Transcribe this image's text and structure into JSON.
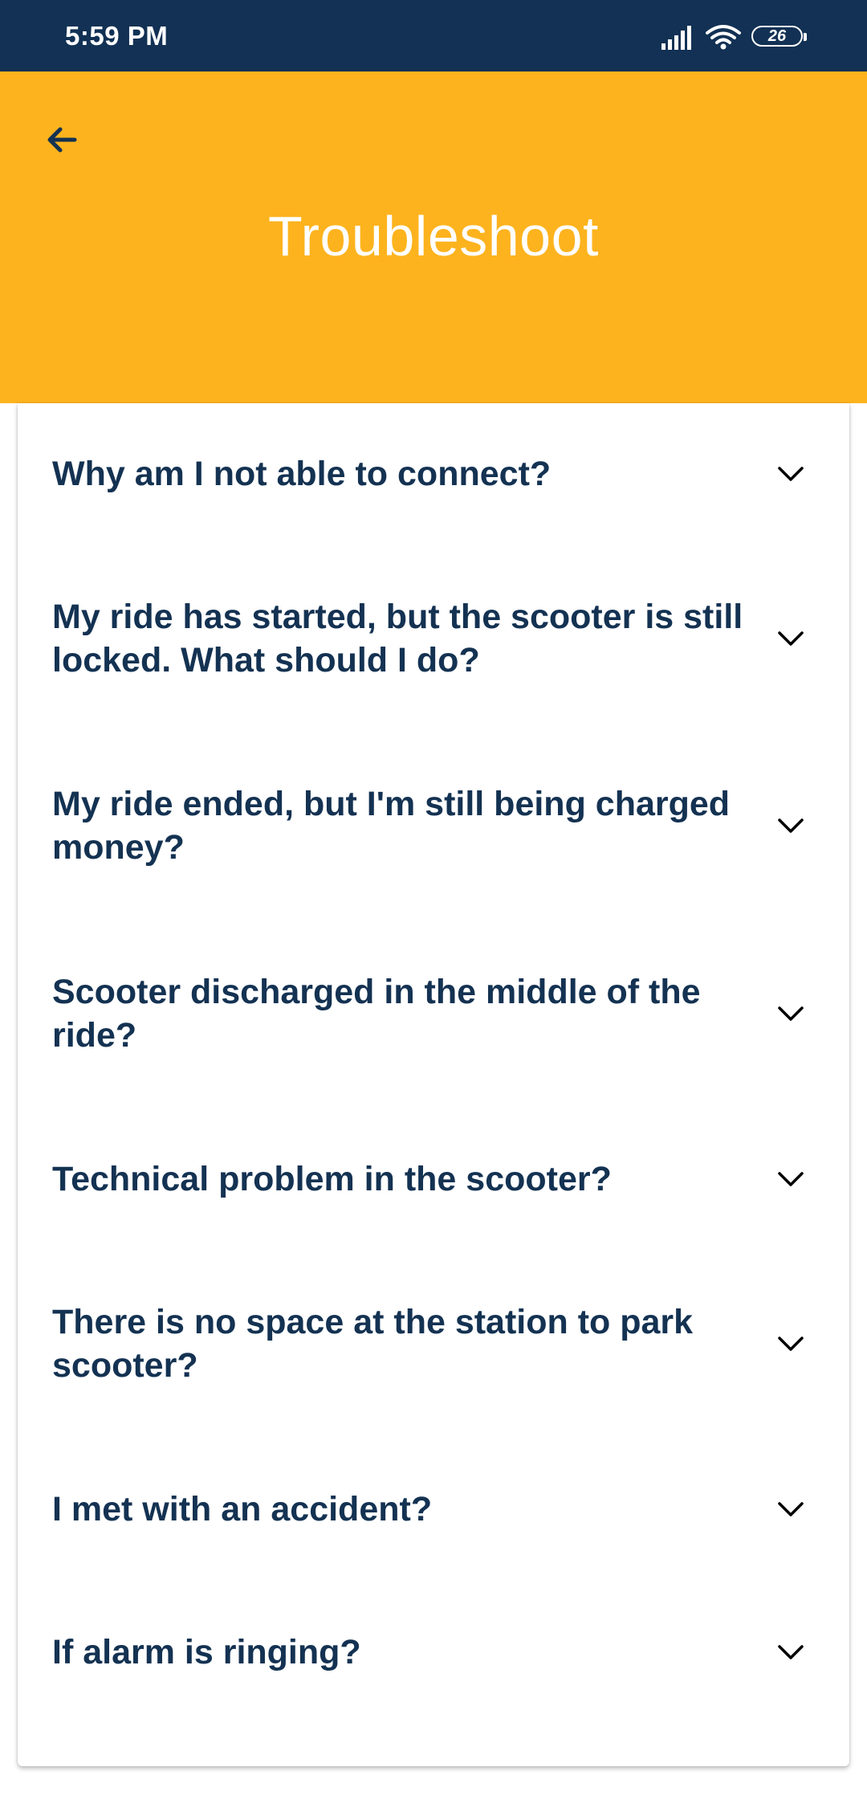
{
  "status_bar": {
    "time": "5:59 PM",
    "battery": "26",
    "icons": [
      "signal-icon",
      "wifi-icon",
      "battery-icon"
    ]
  },
  "header": {
    "title": "Troubleshoot",
    "back_icon": "arrow-left-icon",
    "background": "#fdb31e",
    "title_color": "#ffffff"
  },
  "faq": {
    "text_color": "#143252",
    "chevron_icon": "chevron-down-icon",
    "items": [
      {
        "question": "Why am I not able to connect?"
      },
      {
        "question": "My ride has started, but the scooter is still locked. What should I do?"
      },
      {
        "question": "My ride ended, but I'm still being charged money?"
      },
      {
        "question": "Scooter discharged in the middle of the ride?"
      },
      {
        "question": "Technical problem in the scooter?"
      },
      {
        "question": "There is no space at the station to park scooter?"
      },
      {
        "question": "I met with an accident?"
      },
      {
        "question": "If alarm is ringing?"
      }
    ]
  }
}
